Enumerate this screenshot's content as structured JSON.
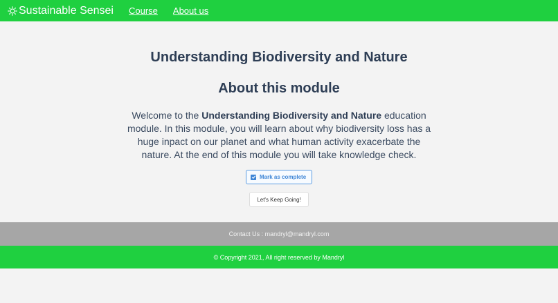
{
  "nav": {
    "brand": "Sustainable Sensei",
    "brand_icon": "sun-icon",
    "links": [
      "Course",
      "About us"
    ]
  },
  "main": {
    "title": "Understanding Biodiversity and Nature",
    "subtitle": "About this module",
    "intro_prefix": "Welcome to the ",
    "intro_bold": "Understanding Biodiversity and Nature",
    "intro_suffix": " education module. In this module, you will learn about why biodiversity loss has a huge inpact on our planet and what human activity exacerbate the nature. At the end of this module you will take knowledge check.",
    "mark_complete_label": "Mark as complete",
    "mark_complete_checked": true,
    "continue_label": "Let's Keep Going!"
  },
  "footer": {
    "contact": "Contact Us : mandryl@mandryl.com",
    "copyright": "© Copyright 2021, All right reserved by Mandryl"
  },
  "colors": {
    "primary_green": "#1fd040",
    "footer_gray": "#a6a6a6",
    "text_dark": "#2e3e55",
    "accent_blue": "#3f86d6"
  }
}
